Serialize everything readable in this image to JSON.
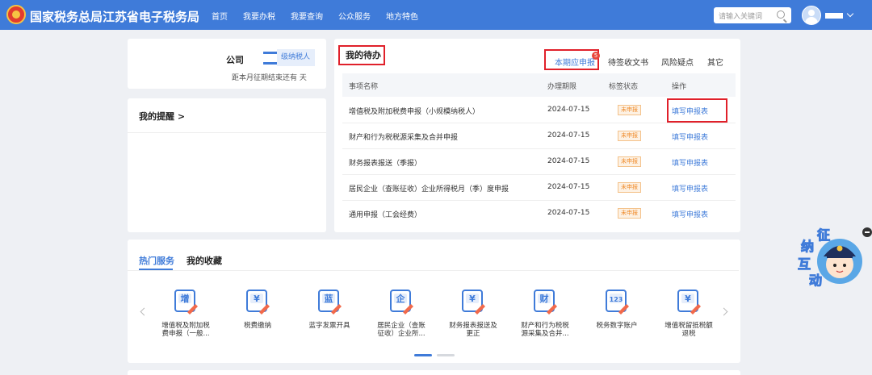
{
  "header": {
    "title": "国家税务总局江苏省电子税务局",
    "nav": [
      "首页",
      "我要办税",
      "我要查询",
      "公众服务",
      "地方特色"
    ],
    "search_placeholder": "请输入关键词"
  },
  "company": {
    "name": "公司",
    "taxpayer_type": "级纳税人",
    "deadline_text": "距本月征期结束还有   天"
  },
  "reminder": {
    "title": "我的提醒 >"
  },
  "todo": {
    "title": "我的待办",
    "tabs": [
      {
        "label": "本期应申报",
        "badge": "5"
      },
      {
        "label": "待签收文书"
      },
      {
        "label": "风险疑点"
      },
      {
        "label": "其它"
      }
    ],
    "columns": [
      "事项名称",
      "办理期限",
      "标签状态",
      "操作"
    ],
    "rows": [
      {
        "name": "增值税及附加税费申报（小规模纳税人）",
        "deadline": "2024-07-15",
        "status": "未申报",
        "action": "填写申报表"
      },
      {
        "name": "财产和行为税税源采集及合并申报",
        "deadline": "2024-07-15",
        "status": "未申报",
        "action": "填写申报表"
      },
      {
        "name": "财务报表报送（季报）",
        "deadline": "2024-07-15",
        "status": "未申报",
        "action": "填写申报表"
      },
      {
        "name": "居民企业（查账征收）企业所得税月（季）度申报",
        "deadline": "2024-07-15",
        "status": "未申报",
        "action": "填写申报表"
      },
      {
        "name": "通用申报（工会经费）",
        "deadline": "2024-07-15",
        "status": "未申报",
        "action": "填写申报表"
      }
    ]
  },
  "services": {
    "tabs": [
      "热门服务",
      "我的收藏"
    ],
    "items": [
      {
        "label1": "增值税及附加税",
        "label2": "费申报（一般...",
        "icon": "vat-declare-icon",
        "glyph": "增"
      },
      {
        "label1": "税费缴纳",
        "label2": "",
        "icon": "tax-payment-icon",
        "glyph": "¥"
      },
      {
        "label1": "蓝字发票开具",
        "label2": "",
        "icon": "invoice-print-icon",
        "glyph": "蓝"
      },
      {
        "label1": "居民企业（查账",
        "label2": "征收）企业所...",
        "icon": "corporate-tax-icon",
        "glyph": "企"
      },
      {
        "label1": "财务报表报送及",
        "label2": "更正",
        "icon": "financial-report-icon",
        "glyph": "¥"
      },
      {
        "label1": "财产和行为税税",
        "label2": "源采集及合并...",
        "icon": "property-tax-icon",
        "glyph": "财"
      },
      {
        "label1": "税务数字账户",
        "label2": "",
        "icon": "digital-account-icon",
        "glyph": "123"
      },
      {
        "label1": "增值税留抵税额",
        "label2": "退税",
        "icon": "vat-refund-icon",
        "glyph": "¥"
      }
    ]
  },
  "mascot": {
    "chars": [
      "征",
      "纳",
      "互",
      "动"
    ]
  },
  "colors": {
    "brand": "#3f7bd9",
    "highlight": "#e0202a",
    "status": "#f08c2c"
  }
}
